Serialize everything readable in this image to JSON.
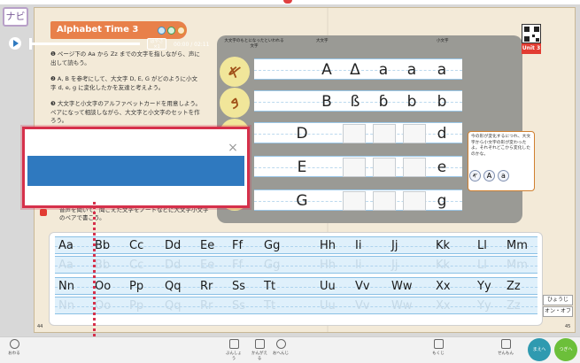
{
  "nav": {
    "label": "ナビ"
  },
  "title": "Alphabet Time 3",
  "instructions": [
    "❶ ページ下の Aa から Zz までの文字を指しながら、声に出して読もう。",
    "❷ A, B を参考にして、大文字 D, E, G がどのように小文字 d, e, g に変化したかを友達と考えよう。",
    "❸ 大文字と小文字のアルファベットカードを用意しよう。ペアになって相談しながら、大文字と小文字のセットを作ろう。"
  ],
  "stone_headers": [
    "大文字のもとになったといわれる文字",
    "大文字",
    "小文字"
  ],
  "rows": [
    {
      "glyph": "𐤀",
      "cells": [
        "A",
        "Δ",
        "a",
        "a",
        "a"
      ]
    },
    {
      "glyph": "𐤁",
      "cells": [
        "B",
        "ß",
        "ɓ",
        "b",
        "b"
      ]
    },
    {
      "glyph": "",
      "cells": [
        "D",
        "",
        "",
        "",
        "d"
      ]
    },
    {
      "glyph": "",
      "cells": [
        "E",
        "",
        "",
        "",
        "e"
      ]
    },
    {
      "glyph": "",
      "cells": [
        "G",
        "",
        "",
        "",
        "g"
      ]
    }
  ],
  "unit_badge": "Unit 3",
  "bubble_text": "今の形が変化するにつれ、大文字から小文字の形が変わったよ。それぞれどこから変化したのかな。",
  "bubble_icons": [
    "𐤀",
    "A",
    "a"
  ],
  "audio_note": "音声を聞いて、聞こえた文字をノートなどに大文字小文字のペアで書こう。",
  "audio_player": {
    "close_label": "×",
    "speed_label": "はやさ ×1",
    "time": "00:00 / 02:11",
    "progress": 0.0
  },
  "alphabet_rows": [
    [
      "Aa",
      "Bb",
      "Cc",
      "Dd",
      "Ee",
      "Ff",
      "Gg",
      "Hh",
      "Ii",
      "Jj",
      "Kk",
      "Ll",
      "Mm"
    ],
    [
      "Nn",
      "Oo",
      "Pp",
      "Qq",
      "Rr",
      "Ss",
      "Tt",
      "Uu",
      "Vv",
      "Ww",
      "Xx",
      "Yy",
      "Zz"
    ]
  ],
  "side_buttons": [
    "ひょうじ",
    "オン・オフ"
  ],
  "page_numbers": {
    "left": "44",
    "right": "45"
  },
  "toolbar": {
    "items": [
      "おわる",
      "ぶんしょう",
      "かんがえる",
      "おへんじ",
      "もくじ",
      "せんもん"
    ],
    "big_buttons": [
      "まえへ",
      "つぎへ"
    ]
  },
  "colors": {
    "accent": "#d6304b",
    "player": "#2f79bf",
    "title": "#e8804a"
  }
}
